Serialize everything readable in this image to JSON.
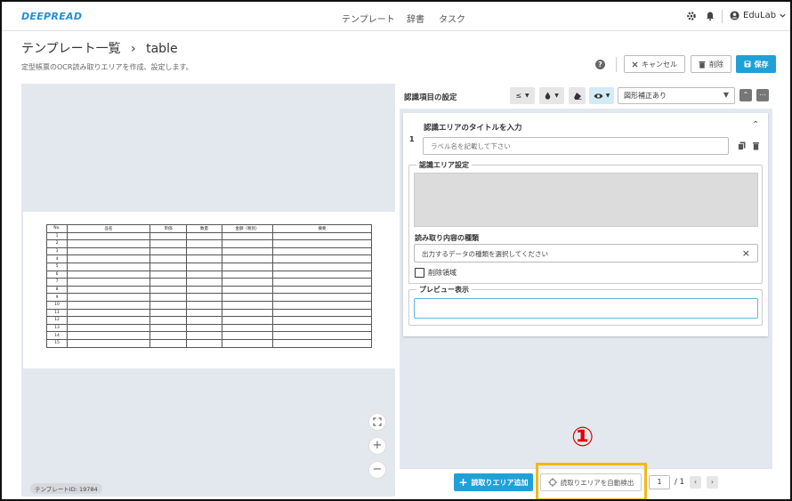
{
  "topbar": {
    "logo": "DEEPREAD",
    "nav": [
      "テンプレート",
      "辞書",
      "タスク"
    ],
    "user": "EduLab"
  },
  "header": {
    "title": "テンプレート一覧",
    "breadcrumb_sep": "›",
    "subtitle_page": "table",
    "description": "定型帳票のOCR読み取りエリアを作成、設定します。",
    "cancel_label": "キャンセル",
    "delete_label": "削除",
    "save_label": "保存",
    "help_glyph": "?"
  },
  "canvas": {
    "template_id": "テンプレートID: 19784",
    "table_headers": [
      "No.",
      "品名",
      "単価",
      "数量",
      "金額（税別）",
      "摘要"
    ],
    "row_numbers": [
      "1",
      "2",
      "3",
      "4",
      "5",
      "6",
      "7",
      "8",
      "9",
      "10",
      "11",
      "12",
      "13",
      "14",
      "15"
    ]
  },
  "panel": {
    "title": "認識項目の設定",
    "tool_lte": "≤",
    "correction_select": "図形補正あり",
    "item_number": "1",
    "item_title": "認識エリアのタイトルを入力",
    "label_placeholder": "ラベル名を記載して下さい",
    "area_legend": "認識エリア設定",
    "read_type_label": "読み取り内容の種類",
    "read_type_value": "出力するデータの種類を選択してください",
    "delete_area_label": "削除領域",
    "preview_legend": "プレビュー表示"
  },
  "bottom": {
    "add_label": "読取りエリア追加",
    "auto_detect_label": "読取りエリアを自動検出",
    "page_current": "1",
    "page_total": "/ 1",
    "annotation": "①"
  },
  "colors": {
    "accent": "#1fa1d8",
    "highlight": "#f2b816",
    "annotation": "#e00000"
  }
}
